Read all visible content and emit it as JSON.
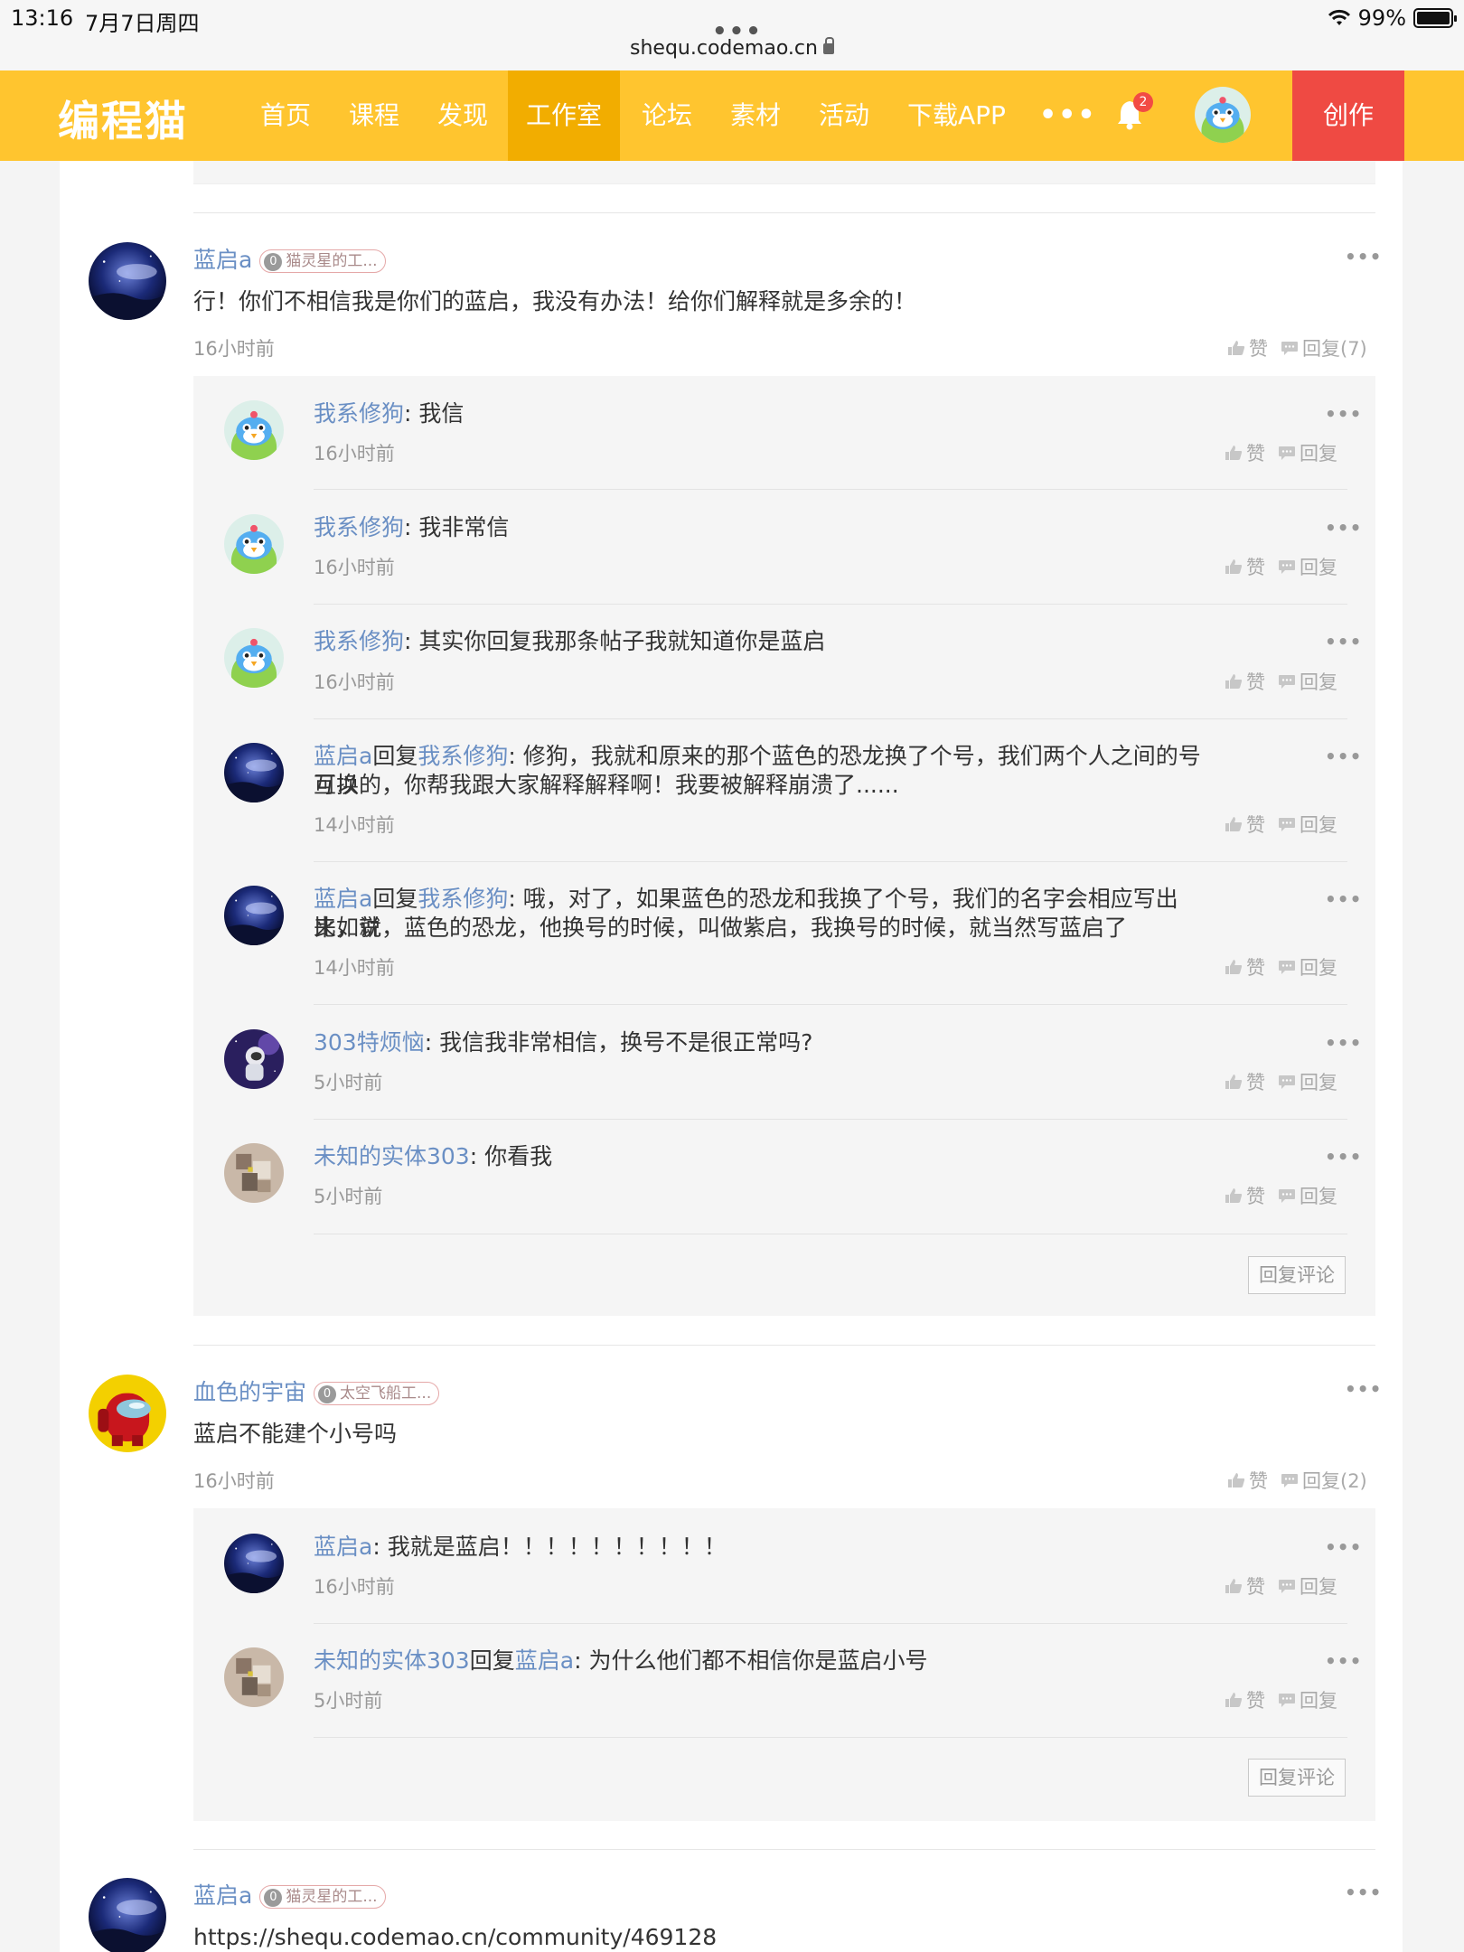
{
  "status": {
    "time": "13:16",
    "date": "7月7日周四",
    "battery": "99%",
    "battery_level": 0.99
  },
  "browser": {
    "url": "shequ.codemao.cn",
    "dots": "•••"
  },
  "nav": {
    "logo": "编程猫",
    "items": [
      "首页",
      "课程",
      "发现",
      "工作室",
      "论坛",
      "素材",
      "活动",
      "下载APP"
    ],
    "active": "工作室",
    "more": "•••",
    "bell_count": "2",
    "create": "创作"
  },
  "labels": {
    "like": "赞",
    "reply": "回复",
    "reply_word": "回复",
    "reply_comment": "回复评论",
    "more": "•••",
    "colon": ":"
  },
  "comments": [
    {
      "user": "蓝启a",
      "badge_level": "0",
      "badge": "猫灵星的工...",
      "text": "行！你们不相信我是你们的蓝启，我没有办法！给你们解释就是多余的！",
      "time": "16小时前",
      "reply_count": "回复(7)",
      "replies": [
        {
          "user": "我系修狗",
          "text": "我信",
          "time": "16小时前"
        },
        {
          "user": "我系修狗",
          "text": "我非常信",
          "time": "16小时前"
        },
        {
          "user": "我系修狗",
          "text": "其实你回复我那条帖子我就知道你是蓝启",
          "time": "16小时前"
        },
        {
          "user": "蓝启a",
          "to": "我系修狗",
          "text1": "修狗，我就和原来的那个蓝色的恐龙换了个号，我们两个人之间的号可以",
          "text2": "互换的，你帮我跟大家解释解释啊！我要被解释崩溃了......",
          "time": "14小时前"
        },
        {
          "user": "蓝启a",
          "to": "我系修狗",
          "text1": "哦，对了，如果蓝色的恐龙和我换了个号，我们的名字会相应写出来，就",
          "text2": "比如说，蓝色的恐龙，他换号的时候，叫做紫启，我换号的时候，就当然写蓝启了",
          "time": "14小时前"
        },
        {
          "user": "303特烦恼",
          "text": "我信我非常相信，换号不是很正常吗?",
          "time": "5小时前"
        },
        {
          "user": "未知的实体303",
          "text": "你看我",
          "time": "5小时前"
        }
      ]
    },
    {
      "user": "血色的宇宙",
      "badge_level": "0",
      "badge": "太空飞船工...",
      "text": "蓝启不能建个小号吗",
      "time": "16小时前",
      "reply_count": "回复(2)",
      "replies": [
        {
          "user": "蓝启a",
          "text": "我就是蓝启！！！！！！！！！！",
          "time": "16小时前"
        },
        {
          "user": "未知的实体303",
          "to": "蓝启a",
          "text": "为什么他们都不相信你是蓝启小号",
          "time": "5小时前"
        }
      ]
    },
    {
      "user": "蓝启a",
      "badge_level": "0",
      "badge": "猫灵星的工...",
      "text": "https://shequ.codemao.cn/community/469128"
    }
  ],
  "colors": {
    "nav": "#ffc52f",
    "nav_active": "#f2ad00",
    "create": "#ef4a43",
    "username": "#6a8fc4"
  }
}
